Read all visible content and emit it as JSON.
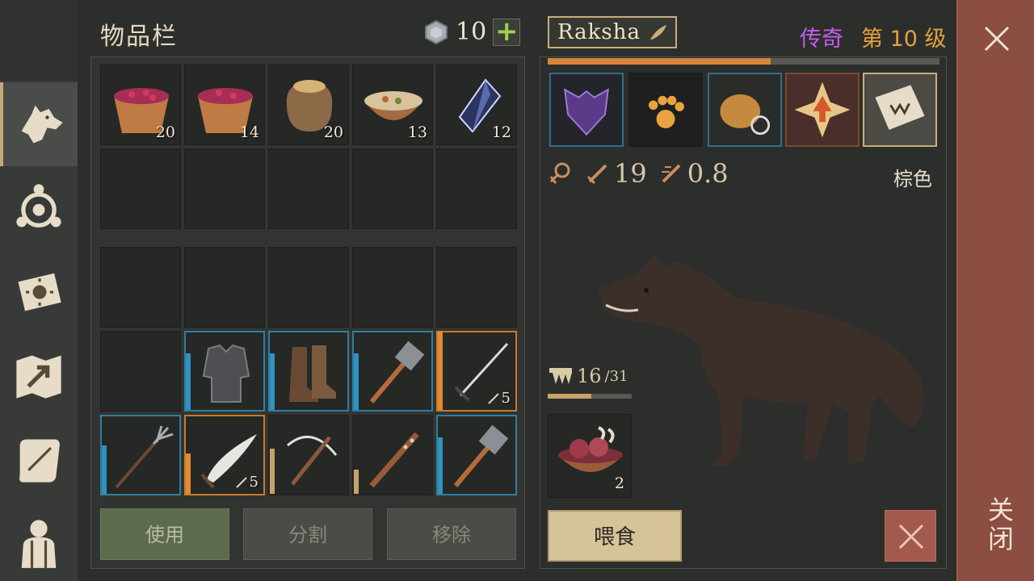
{
  "inventory": {
    "title": "物品栏",
    "currency_value": "10",
    "plus_label": "+",
    "consumables": [
      {
        "icon": "berry-bowl-icon",
        "count": "20"
      },
      {
        "icon": "berry-bowl-icon",
        "count": "14"
      },
      {
        "icon": "grain-sack-icon",
        "count": "20"
      },
      {
        "icon": "stew-bowl-icon",
        "count": "13"
      },
      {
        "icon": "crystal-icon",
        "count": "12"
      }
    ],
    "equipment": [
      {
        "icon": "chainmail-armor-icon",
        "rarity": "blue"
      },
      {
        "icon": "leather-boots-icon",
        "rarity": "blue"
      },
      {
        "icon": "sledgehammer-icon",
        "rarity": "blue"
      },
      {
        "icon": "sword-icon",
        "rarity": "orange",
        "damage": "5"
      },
      {
        "icon": "pitchfork-icon",
        "rarity": "blue"
      },
      {
        "icon": "scimitar-icon",
        "rarity": "orange",
        "damage": "5"
      },
      {
        "icon": "crossbow-icon",
        "rarity": "tan"
      },
      {
        "icon": "spiked-club-icon",
        "rarity": "tan"
      },
      {
        "icon": "sledgehammer-icon",
        "rarity": "blue"
      }
    ],
    "buttons": {
      "use": "使用",
      "split": "分割",
      "remove": "移除"
    }
  },
  "pet": {
    "name": "Raksha",
    "rarity": "传奇",
    "level": "第 10 级",
    "xp_fraction": 0.57,
    "attack": "19",
    "speed": "0.8",
    "color": "棕色",
    "hunger_current": "16",
    "hunger_max": "/31",
    "hunger_fraction": 0.52,
    "food_count": "2",
    "feed_label": "喂食",
    "skills": [
      "wolf-head-icon",
      "paw-print-icon",
      "basket-inspect-icon",
      "sun-arrow-icon",
      "fang-book-icon"
    ]
  },
  "close_label": "关闭",
  "colors": {
    "legendary": "#c35ee8",
    "level": "#e3a23c",
    "blue_rarity": "#2f7ea0",
    "orange_rarity": "#c77a29"
  }
}
